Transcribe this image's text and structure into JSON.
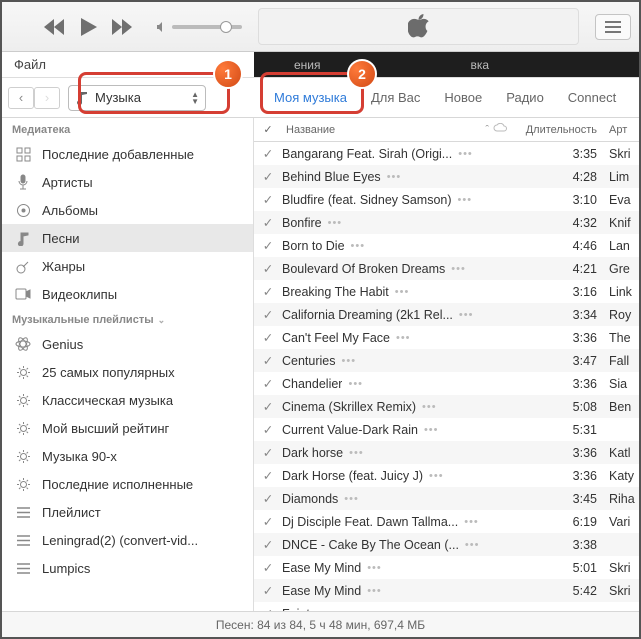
{
  "menubar": {
    "file": "Файл",
    "center_frag": "ения",
    "right_frag": "вка"
  },
  "toolbar": {
    "media_selector_label": "Музыка",
    "tabs": [
      {
        "label": "Моя музыка",
        "active": true
      },
      {
        "label": "Для Вас",
        "active": false
      },
      {
        "label": "Новое",
        "active": false
      },
      {
        "label": "Радио",
        "active": false
      },
      {
        "label": "Connect",
        "active": false
      }
    ]
  },
  "sidebar": {
    "library_header": "Медиатека",
    "library": [
      {
        "label": "Последние добавленные",
        "icon": "grid"
      },
      {
        "label": "Артисты",
        "icon": "mic"
      },
      {
        "label": "Альбомы",
        "icon": "disc"
      },
      {
        "label": "Песни",
        "icon": "note",
        "selected": true
      },
      {
        "label": "Жанры",
        "icon": "guitar"
      },
      {
        "label": "Видеоклипы",
        "icon": "video"
      }
    ],
    "playlists_header": "Музыкальные плейлисты",
    "playlists": [
      {
        "label": "Genius",
        "icon": "atom"
      },
      {
        "label": "25 самых популярных",
        "icon": "gear"
      },
      {
        "label": "Классическая музыка",
        "icon": "gear"
      },
      {
        "label": "Мой высший рейтинг",
        "icon": "gear"
      },
      {
        "label": "Музыка 90-х",
        "icon": "gear"
      },
      {
        "label": "Последние исполненные",
        "icon": "gear"
      },
      {
        "label": "Плейлист",
        "icon": "list"
      },
      {
        "label": "Leningrad(2) (convert-vid...",
        "icon": "list"
      },
      {
        "label": "Lumpics",
        "icon": "list"
      }
    ]
  },
  "columns": {
    "name": "Название",
    "duration": "Длительность",
    "artist": "Арт"
  },
  "tracks": [
    {
      "title": "Bangarang Feat. Sirah (Origi...",
      "dur": "3:35",
      "art": "Skri"
    },
    {
      "title": "Behind Blue Eyes",
      "dur": "4:28",
      "art": "Lim"
    },
    {
      "title": "Bludfire (feat. Sidney Samson)",
      "dur": "3:10",
      "art": "Eva"
    },
    {
      "title": "Bonfire",
      "dur": "4:32",
      "art": "Knif"
    },
    {
      "title": "Born to Die",
      "dur": "4:46",
      "art": "Lan"
    },
    {
      "title": "Boulevard Of Broken Dreams",
      "dur": "4:21",
      "art": "Gre"
    },
    {
      "title": "Breaking The Habit",
      "dur": "3:16",
      "art": "Link"
    },
    {
      "title": "California Dreaming (2k1 Rel...",
      "dur": "3:34",
      "art": "Roy"
    },
    {
      "title": "Can't Feel My Face",
      "dur": "3:36",
      "art": "The"
    },
    {
      "title": "Centuries",
      "dur": "3:47",
      "art": "Fall"
    },
    {
      "title": "Chandelier",
      "dur": "3:36",
      "art": "Sia"
    },
    {
      "title": "Cinema (Skrillex Remix)",
      "dur": "5:08",
      "art": "Ben"
    },
    {
      "title": "Current Value-Dark Rain",
      "dur": "5:31",
      "art": ""
    },
    {
      "title": "Dark horse",
      "dur": "3:36",
      "art": "Katl"
    },
    {
      "title": "Dark Horse (feat. Juicy J)",
      "dur": "3:36",
      "art": "Katy"
    },
    {
      "title": "Diamonds",
      "dur": "3:45",
      "art": "Riha"
    },
    {
      "title": "Dj Disciple Feat. Dawn Tallma...",
      "dur": "6:19",
      "art": "Vari"
    },
    {
      "title": "DNCE - Cake By The Ocean (...",
      "dur": "3:38",
      "art": ""
    },
    {
      "title": "Ease My Mind",
      "dur": "5:01",
      "art": "Skri"
    },
    {
      "title": "Ease My Mind",
      "dur": "5:42",
      "art": "Skri"
    },
    {
      "title": "Faint",
      "dur": "",
      "art": ""
    }
  ],
  "status": "Песен: 84 из 84, 5 ч 48 мин, 697,4 МБ",
  "callouts": {
    "one": "1",
    "two": "2"
  }
}
